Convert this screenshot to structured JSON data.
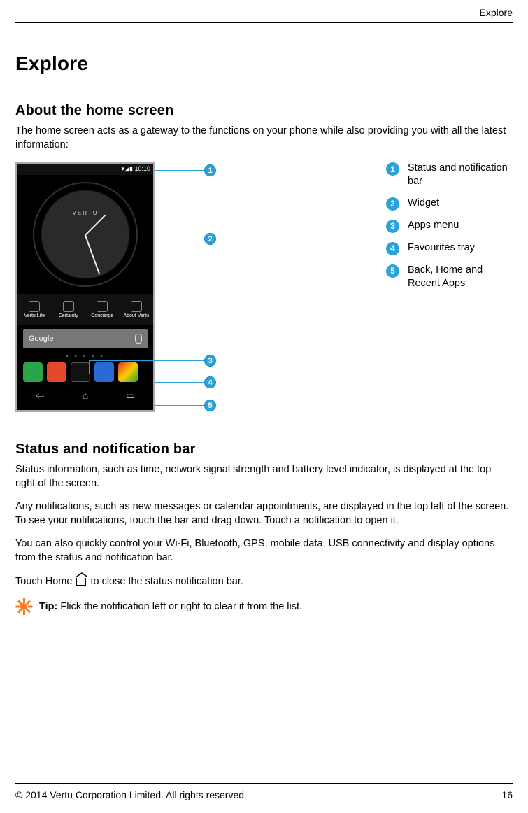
{
  "header": {
    "section": "Explore"
  },
  "chapter": {
    "title": "Explore"
  },
  "section1": {
    "title": "About the home screen",
    "intro": "The home screen acts as a gateway to the functions on your phone while also providing you with all the latest information:"
  },
  "phone": {
    "status_time": "10:10",
    "status_icons": "▾◢▮",
    "clock_brand": "VERTU",
    "shortcuts": [
      "Vertu Life",
      "Certainty",
      "Concierge",
      "About Vertu"
    ],
    "search_label": "Google",
    "nav_back": "⇦",
    "nav_home": "⌂",
    "nav_recent": "▭"
  },
  "legend": [
    {
      "num": "1",
      "label": "Status and notification bar"
    },
    {
      "num": "2",
      "label": "Widget"
    },
    {
      "num": "3",
      "label": "Apps menu"
    },
    {
      "num": "4",
      "label": "Favourites tray"
    },
    {
      "num": "5",
      "label": "Back, Home and Recent Apps"
    }
  ],
  "callout_nums": {
    "n1": "1",
    "n2": "2",
    "n3": "3",
    "n4": "4",
    "n5": "5"
  },
  "section2": {
    "title": "Status and notification bar",
    "p1": "Status information, such as time, network signal strength and battery level indicator, is displayed at the top right of the screen.",
    "p2": "Any notifications, such as new messages or calendar appointments, are displayed in the top left of the screen. To see your notifications, touch the bar and drag down. Touch a notification to open it.",
    "p3": "You can also quickly control your Wi-Fi, Bluetooth, GPS, mobile data, USB connectivity and display options from the status and notification bar.",
    "p4_a": "Touch Home ",
    "p4_b": " to close the status notification bar.",
    "tip_label": "Tip: ",
    "tip_text": "Flick the notification left or right to clear it from the list."
  },
  "footer": {
    "copyright": "© 2014 Vertu Corporation Limited. All rights reserved.",
    "page": "16"
  },
  "fav_colors": [
    "#2aa54a",
    "#e24a2b",
    "#111",
    "#2a6ad4",
    "#d33",
    "#fff"
  ]
}
